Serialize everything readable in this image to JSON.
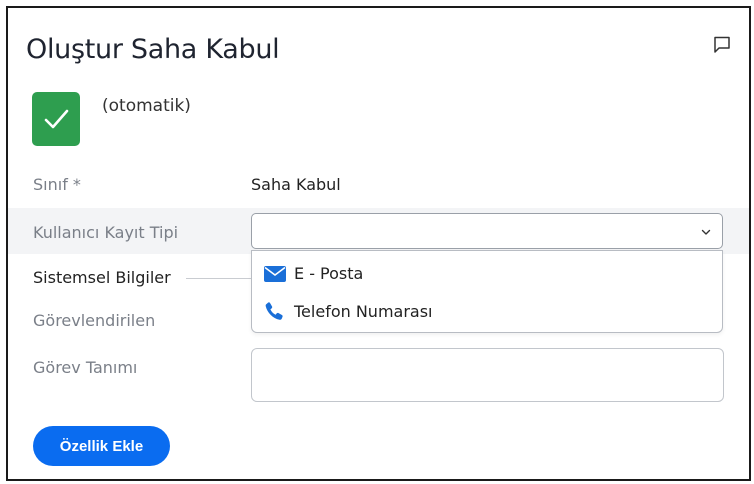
{
  "form": {
    "title": "Oluştur Saha Kabul",
    "auto_label": "(otomatik)"
  },
  "fields": {
    "class_label": "Sınıf *",
    "class_value": "Saha Kabul",
    "user_record_type_label": "Kullanıcı Kayıt Tipi",
    "user_record_type_value": ""
  },
  "dropdown": {
    "options": [
      {
        "label": "E - Posta",
        "icon": "mail-icon"
      },
      {
        "label": "Telefon Numarası",
        "icon": "phone-icon"
      }
    ]
  },
  "section": {
    "title": "Sistemsel Bilgiler",
    "assignee_label": "Görevlendirilen",
    "task_desc_label": "Görev Tanımı"
  },
  "actions": {
    "add_feature_label": "Özellik Ekle"
  },
  "colors": {
    "record_icon": "#2e9e4f",
    "primary_button": "#0a6cf0",
    "dropdown_icon": "#1a6fd8",
    "highlight_row": "#f3f4f6"
  }
}
